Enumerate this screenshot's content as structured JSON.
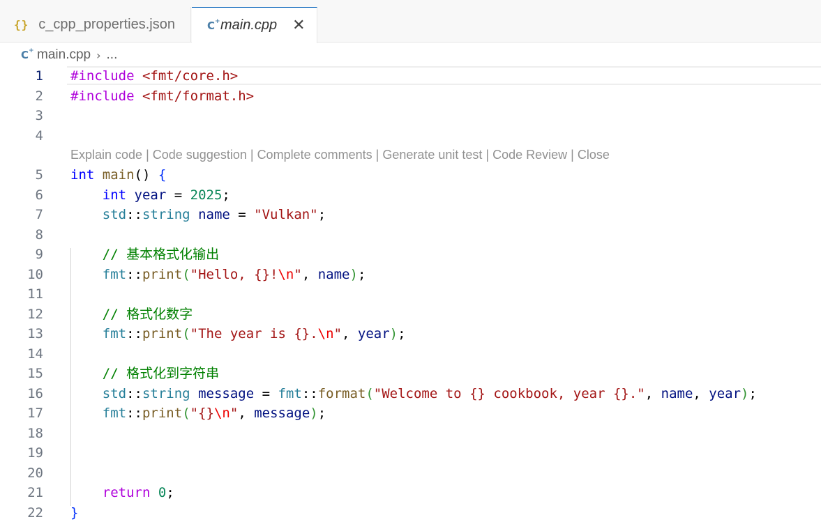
{
  "tabs": [
    {
      "label": "c_cpp_properties.json",
      "icon": "json-braces-icon",
      "active": false
    },
    {
      "label": "main.cpp",
      "icon": "cpp-file-icon",
      "active": true,
      "close": "✕"
    }
  ],
  "breadcrumb": {
    "file": "main.cpp",
    "separator": "›",
    "more": "..."
  },
  "codelens": {
    "items": [
      "Explain code",
      "Code suggestion",
      "Complete comments",
      "Generate unit test",
      "Code Review",
      "Close"
    ],
    "separator": " | "
  },
  "editor": {
    "active_line": 1,
    "lines": [
      {
        "n": "1",
        "tokens": [
          [
            "#include",
            "kw-pre"
          ],
          [
            " ",
            ""
          ],
          [
            "<fmt/core.h>",
            "str"
          ]
        ]
      },
      {
        "n": "2",
        "tokens": [
          [
            "#include",
            "kw-pre"
          ],
          [
            " ",
            ""
          ],
          [
            "<fmt/format.h>",
            "str"
          ]
        ]
      },
      {
        "n": "3",
        "tokens": []
      },
      {
        "n": "4",
        "tokens": []
      },
      {
        "n": "5",
        "tokens": [
          [
            "int",
            "kw"
          ],
          [
            " ",
            ""
          ],
          [
            "main",
            "fn"
          ],
          [
            "() ",
            ""
          ],
          [
            "{",
            "brace"
          ]
        ]
      },
      {
        "n": "6",
        "tokens": [
          [
            "    ",
            ""
          ],
          [
            "int",
            "kw"
          ],
          [
            " ",
            ""
          ],
          [
            "year",
            "var"
          ],
          [
            " = ",
            ""
          ],
          [
            "2025",
            "num"
          ],
          [
            ";",
            ""
          ]
        ]
      },
      {
        "n": "7",
        "tokens": [
          [
            "    ",
            ""
          ],
          [
            "std",
            "ty"
          ],
          [
            "::",
            ""
          ],
          [
            "string",
            "ty"
          ],
          [
            " ",
            ""
          ],
          [
            "name",
            "var"
          ],
          [
            " = ",
            ""
          ],
          [
            "\"Vulkan\"",
            "str"
          ],
          [
            ";",
            ""
          ]
        ]
      },
      {
        "n": "8",
        "tokens": []
      },
      {
        "n": "9",
        "tokens": [
          [
            "    ",
            ""
          ],
          [
            "// 基本格式化输出",
            "cm"
          ]
        ]
      },
      {
        "n": "10",
        "tokens": [
          [
            "    ",
            ""
          ],
          [
            "fmt",
            "ty"
          ],
          [
            "::",
            ""
          ],
          [
            "print",
            "fn"
          ],
          [
            "(",
            "brace2"
          ],
          [
            "\"Hello, {}!",
            "str"
          ],
          [
            "\\n",
            "esc"
          ],
          [
            "\"",
            "str"
          ],
          [
            ", ",
            ""
          ],
          [
            "name",
            "var"
          ],
          [
            ")",
            "brace2"
          ],
          [
            ";",
            ""
          ]
        ]
      },
      {
        "n": "11",
        "tokens": []
      },
      {
        "n": "12",
        "tokens": [
          [
            "    ",
            ""
          ],
          [
            "// 格式化数字",
            "cm"
          ]
        ]
      },
      {
        "n": "13",
        "tokens": [
          [
            "    ",
            ""
          ],
          [
            "fmt",
            "ty"
          ],
          [
            "::",
            ""
          ],
          [
            "print",
            "fn"
          ],
          [
            "(",
            "brace2"
          ],
          [
            "\"The year is {}.",
            "str"
          ],
          [
            "\\n",
            "esc"
          ],
          [
            "\"",
            "str"
          ],
          [
            ", ",
            ""
          ],
          [
            "year",
            "var"
          ],
          [
            ")",
            "brace2"
          ],
          [
            ";",
            ""
          ]
        ]
      },
      {
        "n": "14",
        "tokens": []
      },
      {
        "n": "15",
        "tokens": [
          [
            "    ",
            ""
          ],
          [
            "// 格式化到字符串",
            "cm"
          ]
        ]
      },
      {
        "n": "16",
        "tokens": [
          [
            "    ",
            ""
          ],
          [
            "std",
            "ty"
          ],
          [
            "::",
            ""
          ],
          [
            "string",
            "ty"
          ],
          [
            " ",
            ""
          ],
          [
            "message",
            "var"
          ],
          [
            " = ",
            ""
          ],
          [
            "fmt",
            "ty"
          ],
          [
            "::",
            ""
          ],
          [
            "format",
            "fn"
          ],
          [
            "(",
            "brace2"
          ],
          [
            "\"Welcome to {} cookbook, year {}.\"",
            "str"
          ],
          [
            ", ",
            ""
          ],
          [
            "name",
            "var"
          ],
          [
            ", ",
            ""
          ],
          [
            "year",
            "var"
          ],
          [
            ")",
            "brace2"
          ],
          [
            ";",
            ""
          ]
        ]
      },
      {
        "n": "17",
        "tokens": [
          [
            "    ",
            ""
          ],
          [
            "fmt",
            "ty"
          ],
          [
            "::",
            ""
          ],
          [
            "print",
            "fn"
          ],
          [
            "(",
            "brace2"
          ],
          [
            "\"{}",
            "str"
          ],
          [
            "\\n",
            "esc"
          ],
          [
            "\"",
            "str"
          ],
          [
            ", ",
            ""
          ],
          [
            "message",
            "var"
          ],
          [
            ")",
            "brace2"
          ],
          [
            ";",
            ""
          ]
        ]
      },
      {
        "n": "18",
        "tokens": []
      },
      {
        "n": "19",
        "tokens": []
      },
      {
        "n": "20",
        "tokens": []
      },
      {
        "n": "21",
        "tokens": [
          [
            "    ",
            ""
          ],
          [
            "return",
            "ctrl"
          ],
          [
            " ",
            ""
          ],
          [
            "0",
            "num"
          ],
          [
            ";",
            ""
          ]
        ]
      },
      {
        "n": "22",
        "tokens": [
          [
            "}",
            "brace"
          ]
        ]
      }
    ]
  }
}
